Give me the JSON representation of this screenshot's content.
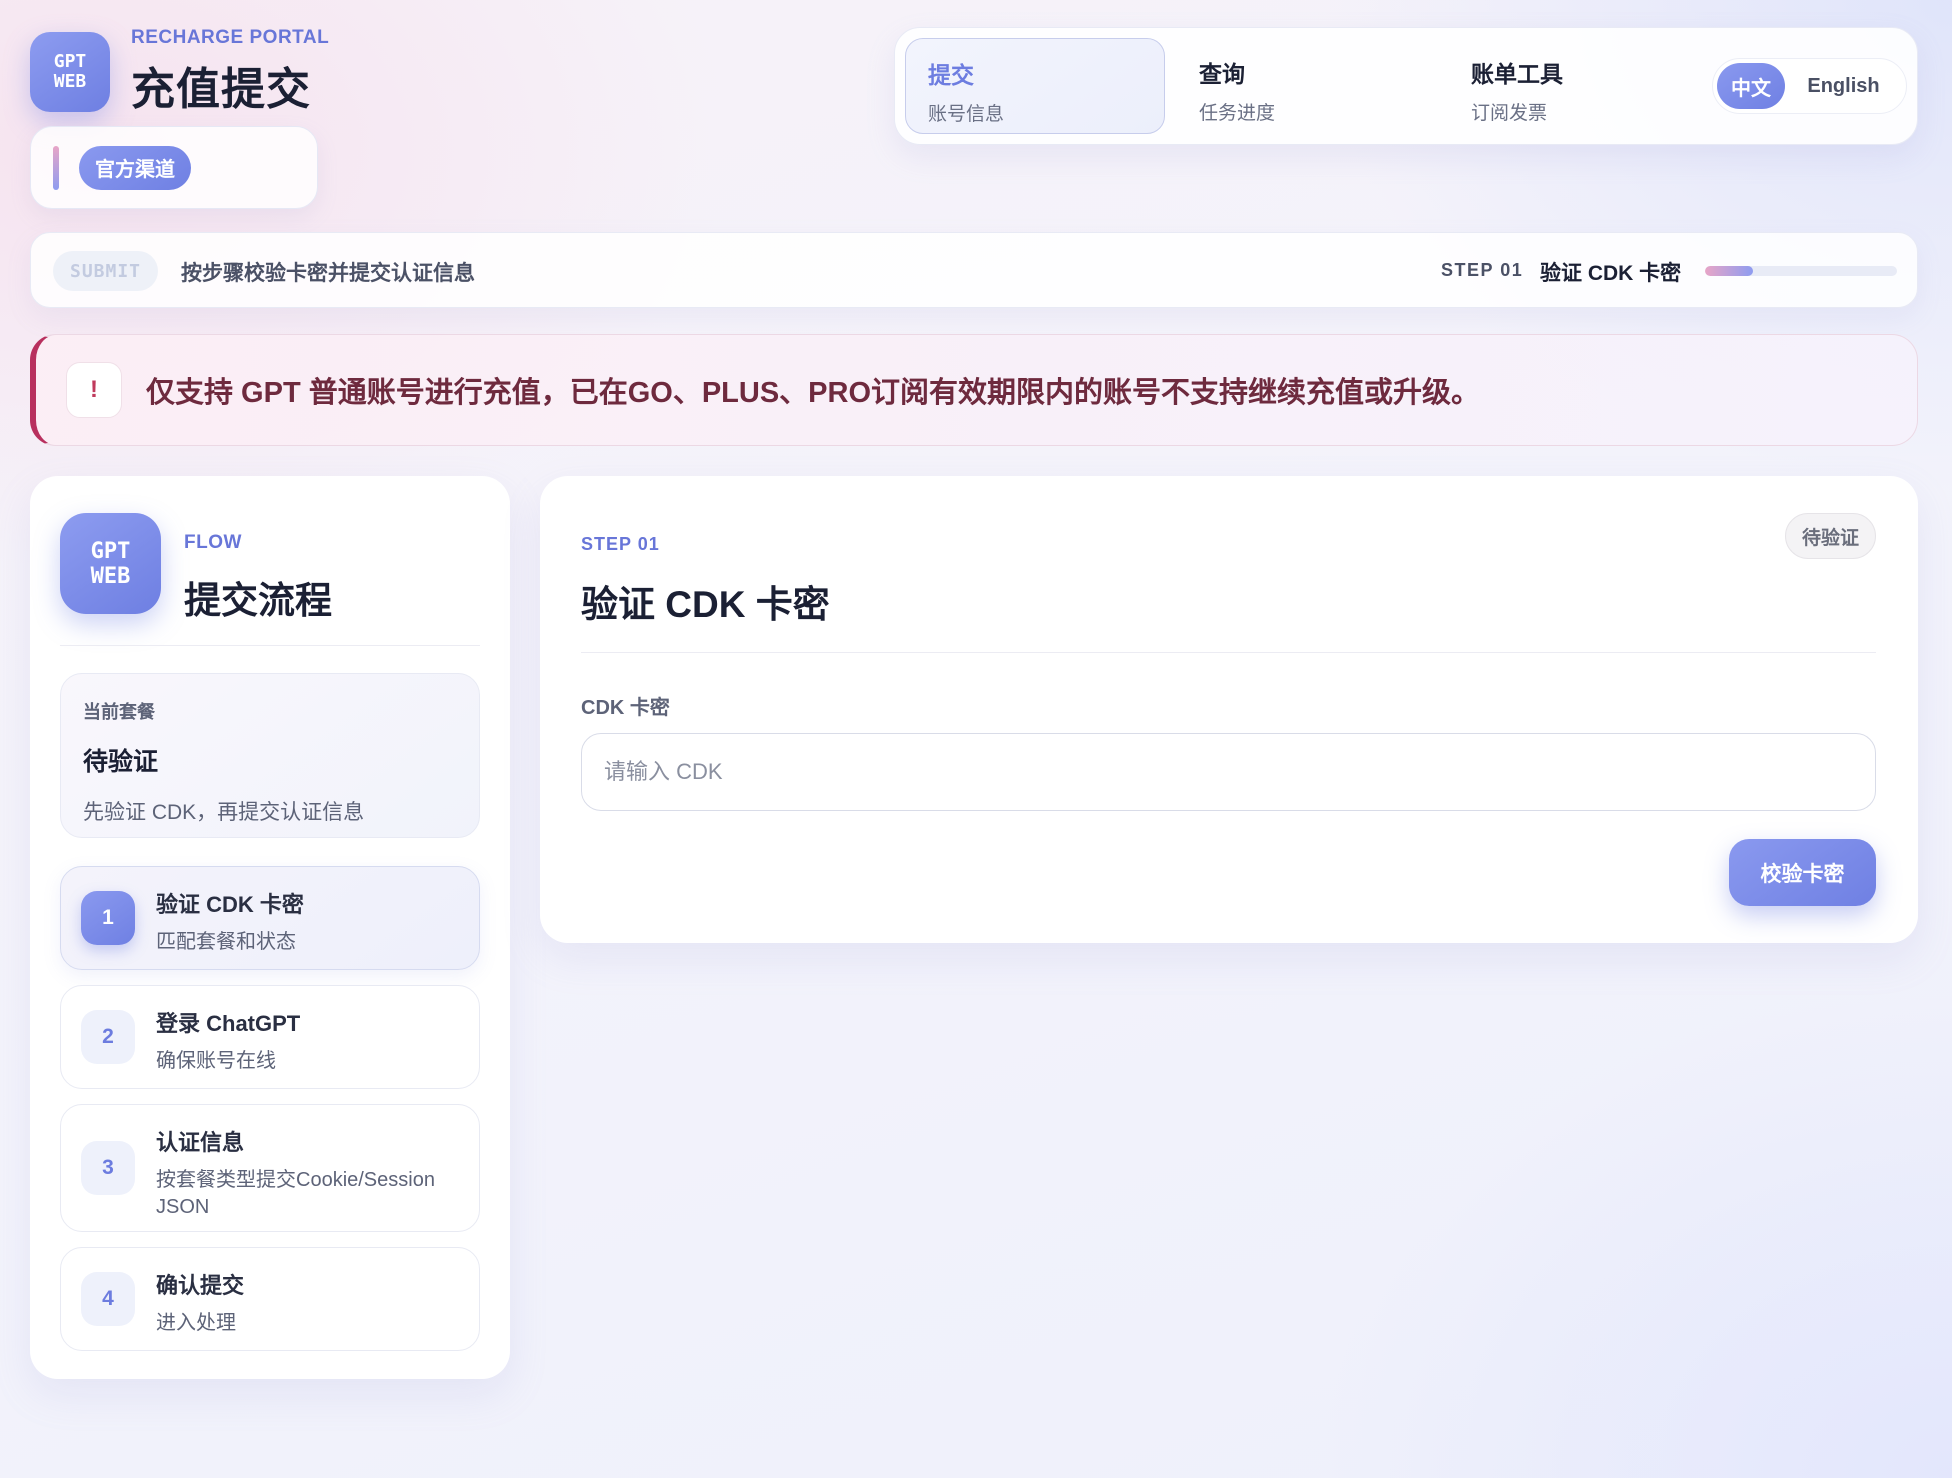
{
  "brand": {
    "logo_line1": "GPT",
    "logo_line2": "WEB",
    "subtitle": "RECHARGE PORTAL",
    "title": "充值提交",
    "channel_label": "官方渠道"
  },
  "nav": {
    "tabs": [
      {
        "label": "提交",
        "sub": "账号信息",
        "active": true
      },
      {
        "label": "查询",
        "sub": "任务进度",
        "active": false
      },
      {
        "label": "账单工具",
        "sub": "订阅发票",
        "active": false
      }
    ],
    "languages": [
      {
        "label": "中文",
        "active": true
      },
      {
        "label": "English",
        "active": false
      }
    ]
  },
  "submit_bar": {
    "tag": "SUBMIT",
    "description": "按步骤校验卡密并提交认证信息",
    "step_label": "STEP 01",
    "step_name": "验证 CDK 卡密",
    "progress_fraction": 0.25
  },
  "alert": {
    "icon": "!",
    "text": "仅支持 GPT 普通账号进行充值，已在GO、PLUS、PRO订阅有效期限内的账号不支持继续充值或升级。"
  },
  "flow": {
    "logo_line1": "GPT",
    "logo_line2": "WEB",
    "subtitle": "FLOW",
    "title": "提交流程",
    "plan": {
      "label": "当前套餐",
      "value": "待验证",
      "description": "先验证 CDK，再提交认证信息"
    },
    "steps": [
      {
        "num": "1",
        "title": "验证 CDK 卡密",
        "desc": "匹配套餐和状态",
        "active": true
      },
      {
        "num": "2",
        "title": "登录 ChatGPT",
        "desc": "确保账号在线",
        "active": false
      },
      {
        "num": "3",
        "title": "认证信息",
        "desc": "按套餐类型提交Cookie/Session JSON",
        "active": false
      },
      {
        "num": "4",
        "title": "确认提交",
        "desc": "进入处理",
        "active": false
      }
    ]
  },
  "main": {
    "step_label": "STEP 01",
    "title": "验证 CDK 卡密",
    "status": "待验证",
    "field_label": "CDK 卡密",
    "input_value": "",
    "input_placeholder": "请输入 CDK",
    "button_label": "校验卡密"
  },
  "colors": {
    "accent": "#6f80e3",
    "accent_light": "#8a99ef",
    "alert_border": "#b8305e",
    "alert_text": "#6e2a3e"
  }
}
